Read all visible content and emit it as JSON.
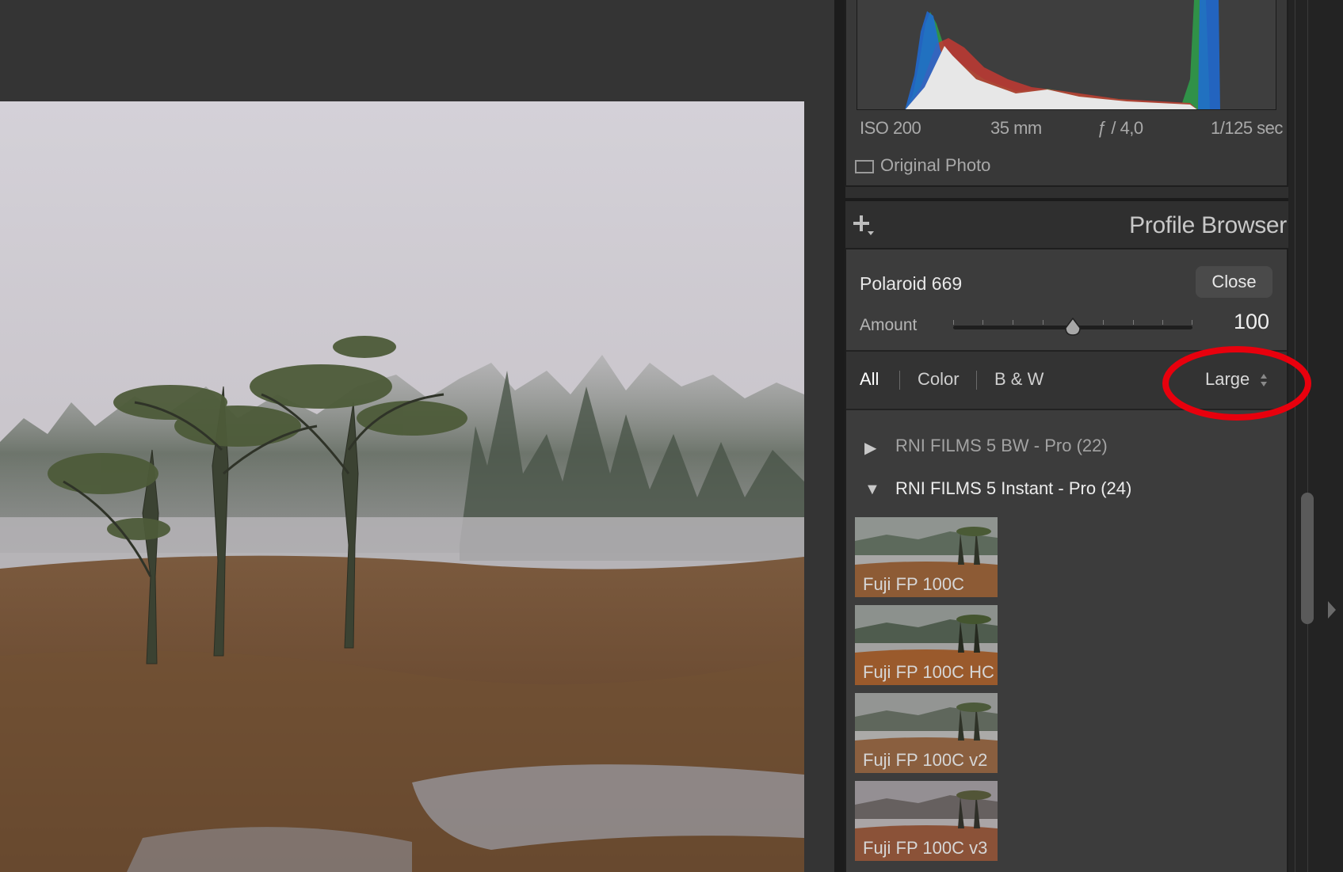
{
  "photo": {
    "description_icon": "landscape-photo"
  },
  "histogram": {
    "exif": {
      "iso": "ISO 200",
      "focal_length": "35 mm",
      "aperture": "ƒ / 4,0",
      "shutter": "1/125 sec"
    },
    "original_photo_label": "Original Photo"
  },
  "profile_browser": {
    "title": "Profile Browser",
    "selected_profile": "Polaroid 669",
    "close_label": "Close",
    "amount_label": "Amount",
    "amount_value": "100",
    "amount_fraction": 0.5,
    "filters": [
      {
        "label": "All",
        "active": true
      },
      {
        "label": "Color",
        "active": false
      },
      {
        "label": "B & W",
        "active": false
      }
    ],
    "size_label": "Large",
    "groups": [
      {
        "label": "RNI FILMS 5 BW - Pro (22)",
        "expanded": false,
        "arrow": "▶"
      },
      {
        "label": "RNI FILMS 5 Instant - Pro (24)",
        "expanded": true,
        "arrow": "▼"
      }
    ],
    "profiles": [
      {
        "label": "Fuji FP 100C"
      },
      {
        "label": "Fuji FP 100C HC"
      },
      {
        "label": "Fuji FP 100C v2"
      },
      {
        "label": "Fuji FP 100C v3"
      }
    ]
  },
  "colors": {
    "highlight": "#e8000d",
    "panel_bg": "#3c3c3c",
    "histogram_blue": "#1f6bd6",
    "histogram_green": "#2ea04a",
    "histogram_red": "#c23a32"
  }
}
